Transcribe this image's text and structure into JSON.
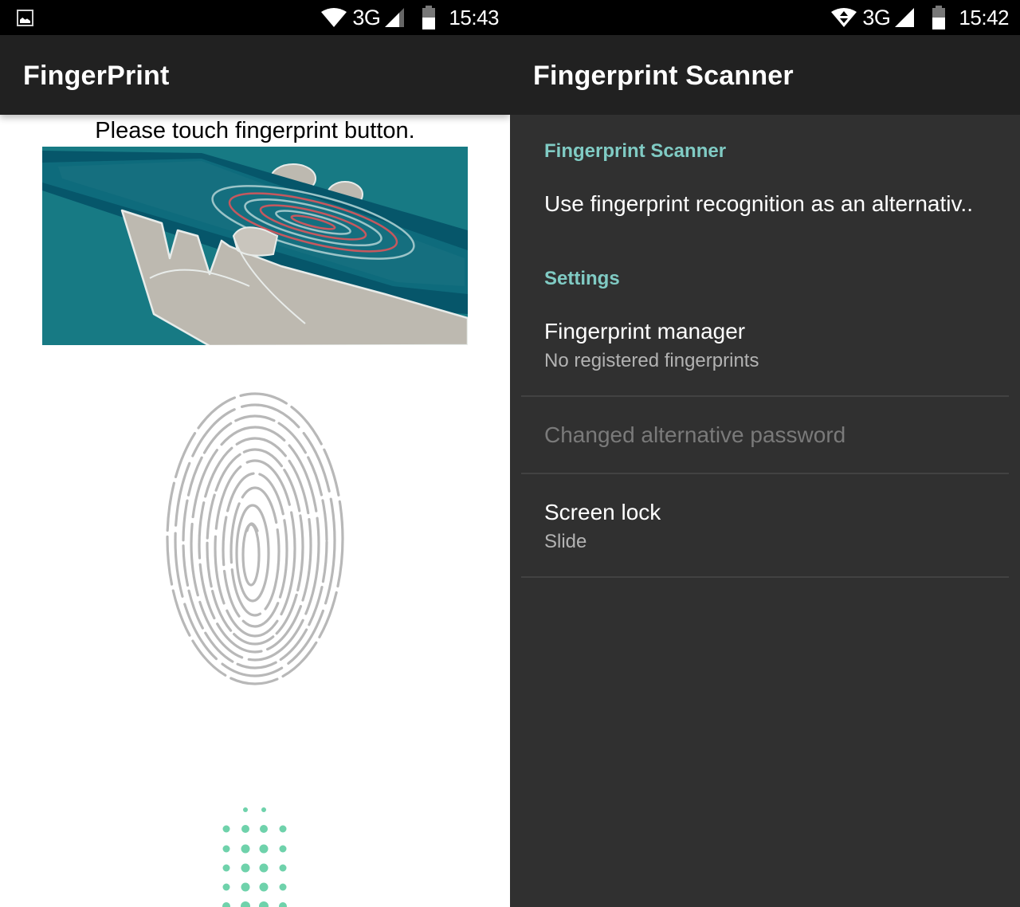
{
  "left_screen": {
    "status_bar": {
      "notification_icon": "image-notification-icon",
      "wifi_icon": "wifi-icon",
      "network_type": "3G",
      "signal_icon": "cell-signal-icon",
      "battery_icon": "battery-icon",
      "time": "15:43"
    },
    "app_bar": {
      "title": "FingerPrint"
    },
    "prompt": "Please touch fingerprint button.",
    "illustration": "hand-holding-phone-fingerprint-illustration",
    "fingerprint_icon": "fingerprint-icon",
    "scan_indicator": "dot-grid-scan-indicator"
  },
  "right_screen": {
    "status_bar": {
      "wifi_icon": "wifi-data-icon",
      "network_type": "3G",
      "signal_icon": "cell-signal-icon",
      "battery_icon": "battery-icon",
      "time": "15:42"
    },
    "app_bar": {
      "title": "Fingerprint Scanner"
    },
    "sections": [
      {
        "header": "Fingerprint Scanner",
        "items": [
          {
            "title": "Use fingerprint recognition as an alternativ..",
            "summary": ""
          }
        ]
      },
      {
        "header": "Settings",
        "items": [
          {
            "title": "Fingerprint manager",
            "summary": "No registered fingerprints",
            "enabled": true
          },
          {
            "title": "Changed alternative password",
            "summary": "",
            "enabled": false
          },
          {
            "title": "Screen lock",
            "summary": "Slide",
            "enabled": true
          }
        ]
      }
    ]
  },
  "colors": {
    "accent": "#80cbc4",
    "app_bar": "#212121",
    "settings_bg": "#303030",
    "dot_green": "#5fcfa4",
    "illustration_teal": "#177a84"
  }
}
